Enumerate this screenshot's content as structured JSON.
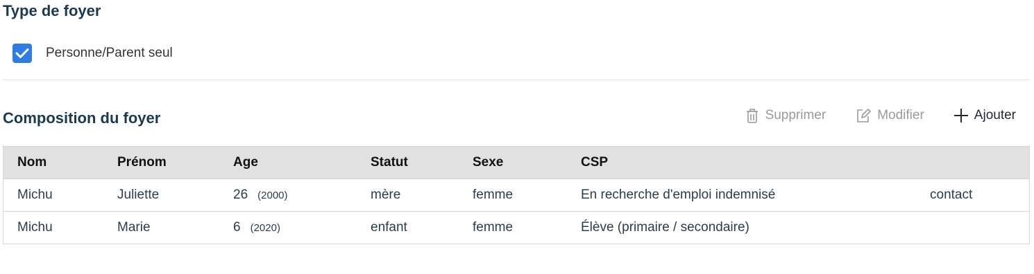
{
  "household_type": {
    "title": "Type de foyer",
    "checkbox_label": "Personne/Parent seul",
    "checked": true
  },
  "composition": {
    "title": "Composition du foyer",
    "toolbar": {
      "delete_label": "Supprimer",
      "edit_label": "Modifier",
      "add_label": "Ajouter"
    },
    "columns": [
      "Nom",
      "Prénom",
      "Age",
      "Statut",
      "Sexe",
      "CSP"
    ],
    "rows": [
      {
        "nom": "Michu",
        "prenom": "Juliette",
        "age": "26",
        "birth_year": "(2000)",
        "statut": "mère",
        "sexe": "femme",
        "csp": "En recherche d'emploi indemnisé",
        "action": "contact"
      },
      {
        "nom": "Michu",
        "prenom": "Marie",
        "age": "6",
        "birth_year": "(2020)",
        "statut": "enfant",
        "sexe": "femme",
        "csp": "Élève (primaire / secondaire)",
        "action": ""
      }
    ]
  },
  "colors": {
    "checkbox": "#2f7de1",
    "header_bg": "#e1e1e1",
    "title": "#1b3a52",
    "disabled": "#9a9a9a"
  }
}
